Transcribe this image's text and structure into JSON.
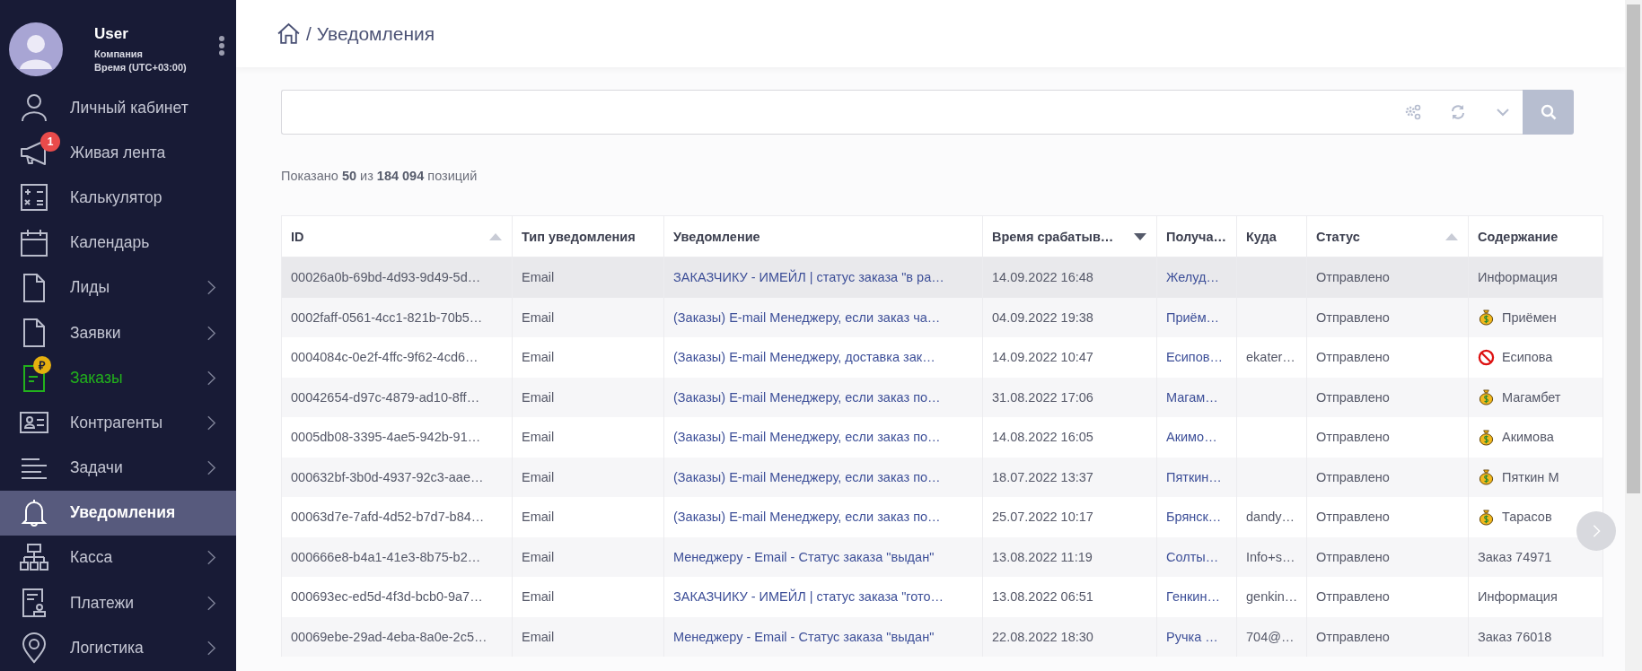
{
  "user": {
    "name": "User",
    "company": "Компания",
    "timezone": "Время (UTC+03:00)"
  },
  "sidebar": {
    "items": [
      {
        "kind": "user",
        "label": "Личный кабинет",
        "expandable": false,
        "selected": false
      },
      {
        "kind": "megaphone",
        "label": "Живая лента",
        "expandable": false,
        "selected": false,
        "badge": "1"
      },
      {
        "kind": "calculator",
        "label": "Калькулятор",
        "expandable": false,
        "selected": false
      },
      {
        "kind": "calendar",
        "label": "Календарь",
        "expandable": false,
        "selected": false
      },
      {
        "kind": "document",
        "label": "Лиды",
        "expandable": true,
        "selected": false
      },
      {
        "kind": "document",
        "label": "Заявки",
        "expandable": true,
        "selected": false
      },
      {
        "kind": "order",
        "label": "Заказы",
        "expandable": true,
        "selected": false,
        "color": "#22b21c",
        "coin": "₽"
      },
      {
        "kind": "contact",
        "label": "Контрагенты",
        "expandable": true,
        "selected": false
      },
      {
        "kind": "lines",
        "label": "Задачи",
        "expandable": true,
        "selected": false
      },
      {
        "kind": "bell",
        "label": "Уведомления",
        "expandable": false,
        "selected": true
      },
      {
        "kind": "hierarchy",
        "label": "Касса",
        "expandable": true,
        "selected": false
      },
      {
        "kind": "payment",
        "label": "Платежи",
        "expandable": true,
        "selected": false
      },
      {
        "kind": "pin",
        "label": "Логистика",
        "expandable": true,
        "selected": false
      }
    ]
  },
  "breadcrumb": {
    "separator": "/",
    "current": "Уведомления"
  },
  "summary": "Показано **50** из **184 094** позиций",
  "table": {
    "columns": [
      {
        "label": "ID",
        "sorted": true,
        "descending": false,
        "kind": "text"
      },
      {
        "label": "Тип уведомления",
        "sorted": false,
        "kind": "text"
      },
      {
        "label": "Уведомление",
        "sorted": false,
        "kind": "link"
      },
      {
        "label": "Время срабатыв…",
        "sorted": true,
        "descending": true,
        "kind": "text"
      },
      {
        "label": "Получа…",
        "sorted": false,
        "kind": "link"
      },
      {
        "label": "Куда",
        "sorted": false,
        "kind": "text"
      },
      {
        "label": "Статус",
        "sorted": true,
        "descending": false,
        "kind": "text"
      },
      {
        "label": "Содержание",
        "sorted": false,
        "kind": "text"
      }
    ],
    "rows": [
      {
        "hovered": true,
        "cells": [
          "00026a0b-69bd-4d93-9d49-5d…",
          "Email",
          "ЗАКАЗЧИКУ - ИМЕЙЛ | статус заказа \"в ра…",
          "14.09.2022 16:48",
          "Желуд…",
          "",
          "Отправлено",
          "Информация"
        ],
        "kind": "none"
      },
      {
        "hovered": false,
        "cells": [
          "0002faff-0561-4cc1-821b-70b5…",
          "Email",
          "(Заказы) E-mail Менеджеру, если заказ ча…",
          "04.09.2022 19:38",
          "Приём…",
          "",
          "Отправлено",
          "Приёмен"
        ],
        "kind": "money-bag"
      },
      {
        "hovered": false,
        "cells": [
          "0004084c-0e2f-4ffc-9f62-4cd6…",
          "Email",
          "(Заказы) E-mail Менеджеру, доставка зак…",
          "14.09.2022 10:47",
          "Есипов…",
          "ekater…",
          "Отправлено",
          "Есипова"
        ],
        "kind": "prohibited"
      },
      {
        "hovered": false,
        "cells": [
          "00042654-d97c-4879-ad10-8ff…",
          "Email",
          "(Заказы) E-mail Менеджеру, если заказ по…",
          "31.08.2022 17:06",
          "Магам…",
          "",
          "Отправлено",
          "Магамбет"
        ],
        "kind": "money-bag"
      },
      {
        "hovered": false,
        "cells": [
          "0005db08-3395-4ae5-942b-91…",
          "Email",
          "(Заказы) E-mail Менеджеру, если заказ по…",
          "14.08.2022 16:05",
          "Акимо…",
          "",
          "Отправлено",
          "Акимова"
        ],
        "kind": "money-bag"
      },
      {
        "hovered": false,
        "cells": [
          "000632bf-3b0d-4937-92c3-aae…",
          "Email",
          "(Заказы) E-mail Менеджеру, если заказ по…",
          "18.07.2022 13:37",
          "Пяткин…",
          "",
          "Отправлено",
          "Пяткин М"
        ],
        "kind": "money-bag"
      },
      {
        "hovered": false,
        "cells": [
          "00063d7e-7afd-4d52-b7d7-b84…",
          "Email",
          "(Заказы) E-mail Менеджеру, если заказ по…",
          "25.07.2022 10:17",
          "Брянск…",
          "dandy…",
          "Отправлено",
          "Тарасов"
        ],
        "kind": "money-bag"
      },
      {
        "hovered": false,
        "cells": [
          "000666e8-b4a1-41e3-8b75-b2…",
          "Email",
          "Менеджеру - Email - Статус заказа \"выдан\"",
          "13.08.2022 11:19",
          "Солты…",
          "Info+s…",
          "Отправлено",
          "Заказ 74971"
        ],
        "kind": "none"
      },
      {
        "hovered": false,
        "cells": [
          "000693ec-ed5d-4f3d-bcb0-9a7…",
          "Email",
          "ЗАКАЗЧИКУ - ИМЕЙЛ | статус заказа \"гото…",
          "13.08.2022 06:51",
          "Генкин…",
          "genkin…",
          "Отправлено",
          "Информация"
        ],
        "kind": "none"
      },
      {
        "hovered": false,
        "cells": [
          "00069ebe-29ad-4eba-8a0e-2c5…",
          "Email",
          "Менеджеру - Email - Статус заказа \"выдан\"",
          "22.08.2022 18:30",
          "Ручка …",
          "704@…",
          "Отправлено",
          "Заказ 76018"
        ],
        "kind": "none"
      }
    ]
  }
}
